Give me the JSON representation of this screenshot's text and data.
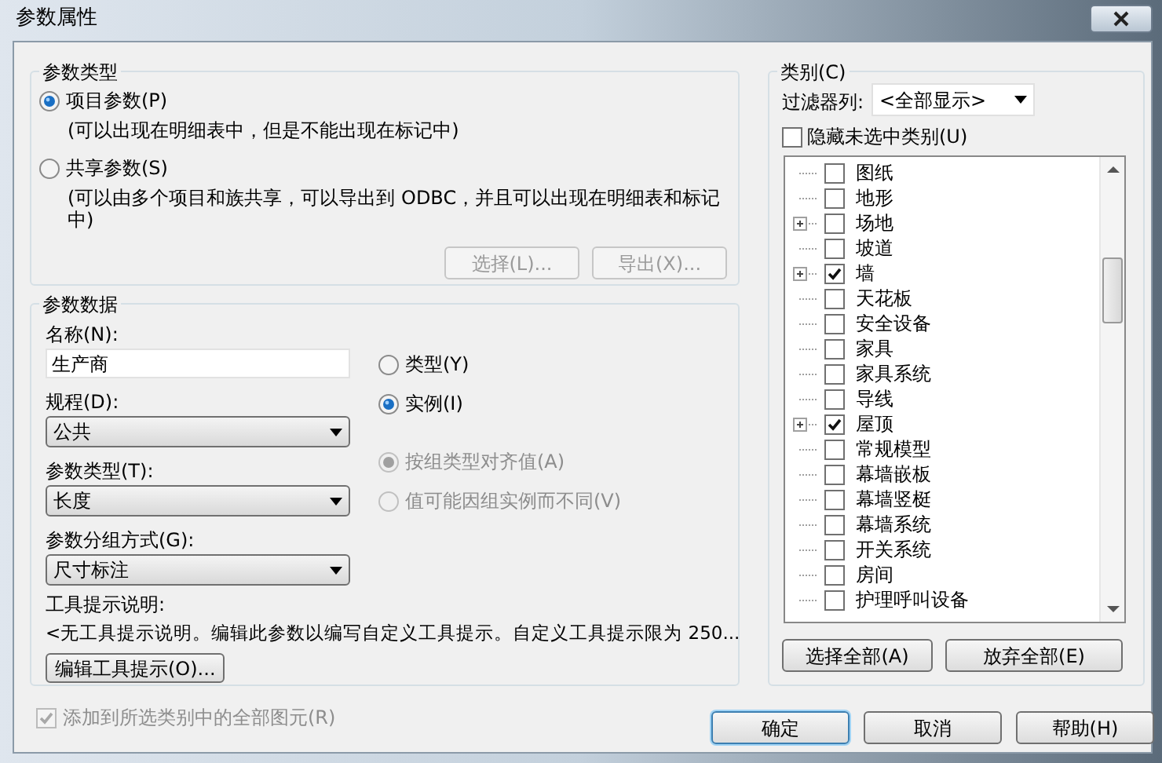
{
  "window": {
    "title": "参数属性"
  },
  "parameter_type": {
    "title": "参数类型",
    "options": [
      {
        "label": "项目参数(P)",
        "description": "(可以出现在明细表中，但是不能出现在标记中)",
        "selected": true
      },
      {
        "label": "共享参数(S)",
        "description": "(可以由多个项目和族共享，可以导出到 ODBC，并且可以出现在明细表和标记中)",
        "selected": false
      }
    ],
    "buttons": [
      {
        "label": "选择(L)...",
        "disabled": true
      },
      {
        "label": "导出(X)...",
        "disabled": true
      }
    ]
  },
  "parameter_data": {
    "title": "参数数据",
    "name_label": "名称(N):",
    "name_value": "生产商",
    "dropdowns": [
      {
        "label": "规程(D):",
        "value": "公共"
      },
      {
        "label": "参数类型(T):",
        "value": "长度"
      },
      {
        "label": "参数分组方式(G):",
        "value": "尺寸标注"
      }
    ],
    "tooltip_label": "工具提示说明:",
    "tooltip_text": "<无工具提示说明。编辑此参数以编写自定义工具提示。自定义工具提示限为 250...",
    "tooltip_button": "编辑工具提示(O)...",
    "scope": [
      {
        "label": "类型(Y)",
        "selected": false,
        "disabled": false
      },
      {
        "label": "实例(I)",
        "selected": true,
        "disabled": false
      }
    ],
    "group_values": [
      {
        "label": "按组类型对齐值(A)",
        "selected": true,
        "disabled": true
      },
      {
        "label": "值可能因组实例而不同(V)",
        "selected": false,
        "disabled": true
      }
    ]
  },
  "add_to_all": {
    "label": "添加到所选类别中的全部图元(R)",
    "checked": true,
    "disabled": true
  },
  "categories": {
    "title": "类别(C)",
    "filter_label": "过滤器列:",
    "filter_value": "<全部显示>",
    "hide_unchecked": {
      "label": "隐藏未选中类别(U)",
      "checked": false
    },
    "items": [
      {
        "label": "图纸",
        "checked": false,
        "expandable": false
      },
      {
        "label": "地形",
        "checked": false,
        "expandable": false
      },
      {
        "label": "场地",
        "checked": false,
        "expandable": true
      },
      {
        "label": "坡道",
        "checked": false,
        "expandable": false
      },
      {
        "label": "墙",
        "checked": true,
        "expandable": true
      },
      {
        "label": "天花板",
        "checked": false,
        "expandable": false
      },
      {
        "label": "安全设备",
        "checked": false,
        "expandable": false
      },
      {
        "label": "家具",
        "checked": false,
        "expandable": false
      },
      {
        "label": "家具系统",
        "checked": false,
        "expandable": false
      },
      {
        "label": "导线",
        "checked": false,
        "expandable": false
      },
      {
        "label": "屋顶",
        "checked": true,
        "expandable": true
      },
      {
        "label": "常规模型",
        "checked": false,
        "expandable": false
      },
      {
        "label": "幕墙嵌板",
        "checked": false,
        "expandable": false
      },
      {
        "label": "幕墙竖梃",
        "checked": false,
        "expandable": false
      },
      {
        "label": "幕墙系统",
        "checked": false,
        "expandable": false
      },
      {
        "label": "开关系统",
        "checked": false,
        "expandable": false
      },
      {
        "label": "房间",
        "checked": false,
        "expandable": false
      },
      {
        "label": "护理呼叫设备",
        "checked": false,
        "expandable": false
      }
    ],
    "buttons": [
      "选择全部(A)",
      "放弃全部(E)"
    ]
  },
  "dialog_buttons": [
    {
      "label": "确定",
      "default": true
    },
    {
      "label": "取消",
      "default": false
    },
    {
      "label": "帮助(H)",
      "default": false
    }
  ]
}
